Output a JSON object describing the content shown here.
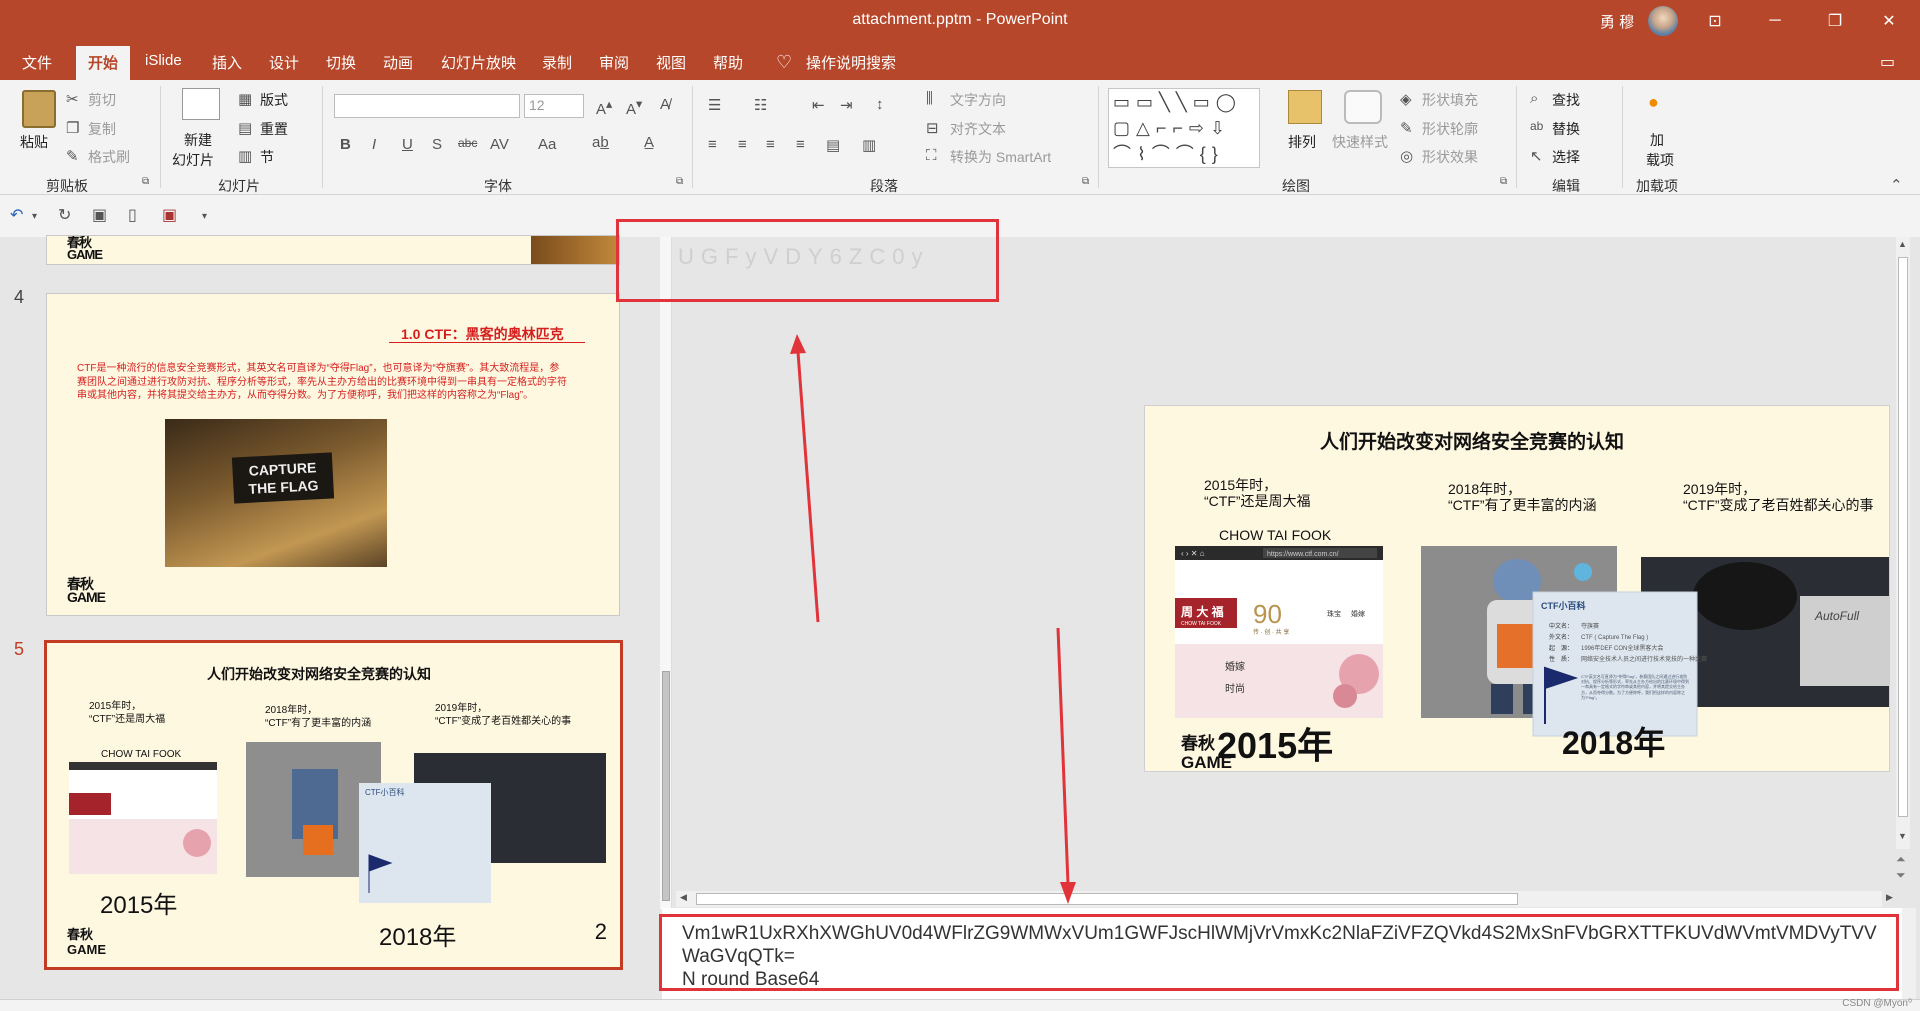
{
  "window": {
    "title": "attachment.pptm  -  PowerPoint",
    "user": "勇 穆",
    "controls": {
      "ribbon_display": "⊡",
      "minimize": "─",
      "maximize": "❐",
      "close": "✕"
    }
  },
  "menu": {
    "items": [
      "文件",
      "开始",
      "iSlide",
      "插入",
      "设计",
      "切换",
      "动画",
      "幻灯片放映",
      "录制",
      "审阅",
      "视图",
      "帮助"
    ],
    "active": "开始",
    "tell_me": "操作说明搜索",
    "comments_icon": "comment-icon"
  },
  "ribbon": {
    "clipboard": {
      "label": "剪贴板",
      "paste": "粘贴",
      "cut": "剪切",
      "copy": "复制",
      "format_painter": "格式刷"
    },
    "slides": {
      "label": "幻灯片",
      "new_slide_1": "新建",
      "new_slide_2": "幻灯片",
      "layout": "版式",
      "reset": "重置",
      "section": "节"
    },
    "font": {
      "label": "字体",
      "font_name": "",
      "font_size": "12",
      "bold": "B",
      "italic": "I",
      "underline": "U",
      "shadow": "S",
      "strike": "abc",
      "spacing": "AV",
      "case": "Aa"
    },
    "paragraph": {
      "label": "段落",
      "text_direction": "文字方向",
      "align_text": "对齐文本",
      "smartart": "转换为 SmartArt"
    },
    "drawing": {
      "label": "绘图",
      "arrange": "排列",
      "quick_styles": "快速样式",
      "shape_fill": "形状填充",
      "shape_outline": "形状轮廓",
      "shape_effects": "形状效果"
    },
    "editing": {
      "label": "编辑",
      "find": "查找",
      "replace": "替换",
      "select": "选择"
    },
    "addins": {
      "label": "加载项",
      "button_1": "加",
      "button_2": "载项"
    }
  },
  "slides": {
    "prev_partial": {
      "logo_1": "春秋",
      "logo_2": "GAME"
    },
    "slide4": {
      "number": "4",
      "title": "1.0   CTF：黑客的奥林匹克",
      "body": "CTF是一种流行的信息安全竞赛形式，其英文名可直译为“夺得Flag”，也可意译为“夺旗赛”。其大致流程是，参赛团队之间通过进行攻防对抗、程序分析等形式，率先从主办方给出的比赛环境中得到一串具有一定格式的字符串或其他内容，并将其提交给主办方，从而夺得分数。为了方便称呼，我们把这样的内容称之为“Flag”。",
      "image_text_1": "CAPTURE",
      "image_text_2": "THE FLAG",
      "logo_1": "春秋",
      "logo_2": "GAME"
    },
    "slide5": {
      "number": "5",
      "page_marker": "2"
    }
  },
  "main_slide": {
    "title": "人们开始改变对网络安全竞赛的认知",
    "col1_l1": "2015年时，",
    "col1_l2": "“CTF”还是周大福",
    "col2_l1": "2018年时，",
    "col2_l2": "“CTF”有了更丰富的内涵",
    "col3_l1": "2019年时，",
    "col3_l2": "“CTF”变成了老百姓都关心的事",
    "chow_label": "CHOW TAI FOOK",
    "browser_url": "https://www.ctf.com.cn/",
    "ctf_brand": "周 大 福",
    "ctf_brand_sub": "CHOW TAI FOOK",
    "ctf_90": "90",
    "ctf_90_sub": "传 · 创 · 共 享",
    "ctf_tab1": "珠宝",
    "ctf_tab2": "婚嫁",
    "ctf_menu1": "婚嫁",
    "ctf_menu2": "时尚",
    "year_2015": "2015年",
    "year_2018": "2018年",
    "baike_title": "CTF小百科",
    "baike_rows": [
      {
        "k": "中文名：",
        "v": "夺旗赛"
      },
      {
        "k": "外文名：",
        "v": "CTF ( Capture The Flag )"
      },
      {
        "k": "起　源：",
        "v": "1996年DEF CON全球黑客大会"
      },
      {
        "k": "性　质：",
        "v": "网络安全技术人员之间进行技术竞技的一种比赛"
      }
    ],
    "baike_desc": "CTF英文名可直译为“夺得Flag”，参赛团队之间通过进行攻防对抗、程序分析等形式，率先从主办方给出的比赛环境中得到一串具有一定格式的字符串或其他内容，并将其提交给主办方，从而夺得分数。为了方便称呼，我们把这样的内容称之为“Flag”。",
    "photo_brand": "AutoFull",
    "logo_1": "春秋",
    "logo_2": "GAME"
  },
  "hidden_text": "UGFyVDY6ZC0y",
  "notes": {
    "line1": "Vm1wR1UxRXhXWGhUV0d4WFlrZG9WMWxVUm1GWFJscHlWMjVrVmxKc2NlaFZiVFZQVkd4S2MxSnFVbGRXTTFKUVdWVmtVMDVyTVV",
    "line2": "WaGVqQTk=",
    "line3": "N round Base64"
  },
  "status": {
    "watermark": "CSDN @Myon⁰"
  }
}
